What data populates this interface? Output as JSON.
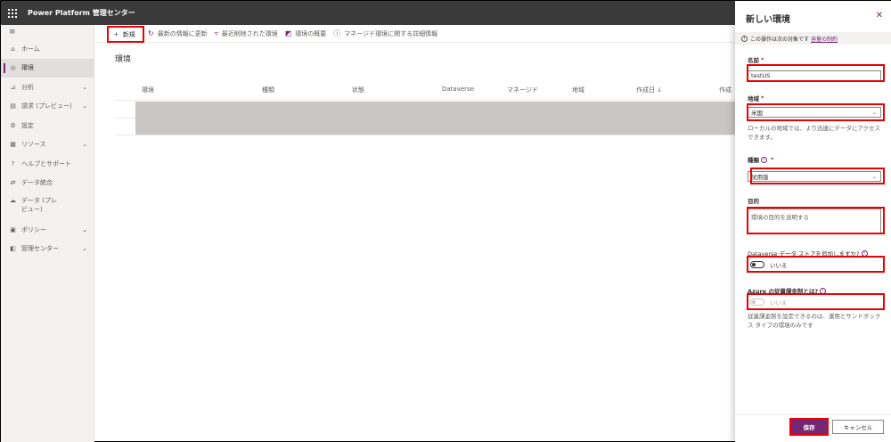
{
  "app": {
    "title": "Power Platform 管理センター"
  },
  "sidebar": {
    "items": [
      {
        "label": "ホーム",
        "icon": "home-icon",
        "chevron": false,
        "active": false
      },
      {
        "label": "環境",
        "icon": "environment-icon",
        "chevron": false,
        "active": true
      },
      {
        "label": "分析",
        "icon": "chart-icon",
        "chevron": true,
        "active": false
      },
      {
        "label": "請求 (プレビュー)",
        "icon": "billing-icon",
        "chevron": true,
        "active": false
      },
      {
        "label": "設定",
        "icon": "gear-icon",
        "chevron": false,
        "active": false
      },
      {
        "label": "リソース",
        "icon": "resource-icon",
        "chevron": true,
        "active": false
      },
      {
        "label": "ヘルプとサポート",
        "icon": "help-icon",
        "chevron": false,
        "active": false
      },
      {
        "label": "データ統合",
        "icon": "data-integration-icon",
        "chevron": false,
        "active": false
      },
      {
        "label": "データ (プレビュー)",
        "icon": "data-gateway-icon",
        "chevron": false,
        "active": false
      },
      {
        "label": "ポリシー",
        "icon": "policy-icon",
        "chevron": true,
        "active": false
      },
      {
        "label": "管理センター",
        "icon": "admin-center-icon",
        "chevron": true,
        "active": false
      }
    ]
  },
  "commandbar": {
    "new_label": "新規",
    "refresh_label": "最新の情報に更新",
    "deleted_label": "最近削除された環境",
    "overview_label": "環境の概要",
    "managed_label": "マネージド環境に関する詳細情報"
  },
  "main": {
    "title": "環境",
    "columns": [
      "環境",
      "種類",
      "状態",
      "Dataverse",
      "マネージド",
      "地域",
      "作成日 ↓",
      "作成"
    ]
  },
  "panel": {
    "title": "新しい環境",
    "info_text": "この操作は次の対象です",
    "info_link": "容量の制約",
    "name_label": "名前",
    "name_value": "testUS",
    "region_label": "地域",
    "region_value": "米国",
    "region_helper": "ローカルの地域では、より迅速にデータにアクセスできます。",
    "type_label": "種類",
    "type_value": "試用版",
    "purpose_label": "目的",
    "purpose_placeholder": "環境の目的を説明する",
    "dataverse_label": "Dataverse データ ストアを追加しますか?",
    "dataverse_value": "いいえ",
    "azure_label": "Azure の従量課金制とは?",
    "azure_value": "いいえ",
    "azure_helper": "従量課金制を設定できるのは、運用とサンドボックス タイプの環境のみです",
    "save_label": "保存",
    "cancel_label": "キャンセル"
  },
  "colors": {
    "accent": "#742774",
    "highlight": "#ee0000",
    "topbar": "#3a3a3a"
  }
}
